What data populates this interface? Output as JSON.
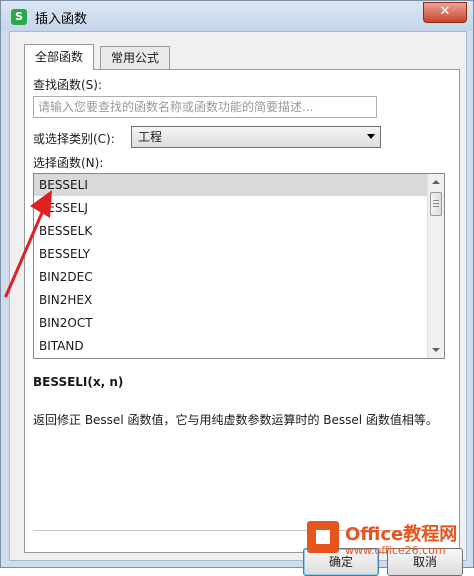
{
  "window": {
    "title": "插入函数",
    "app_icon": "S",
    "close_label": "✕"
  },
  "tabs": [
    {
      "label": "全部函数",
      "active": true
    },
    {
      "label": "常用公式",
      "active": false
    }
  ],
  "search": {
    "label": "查找函数(S):",
    "placeholder": "请输入您要查找的函数名称或函数功能的简要描述..."
  },
  "category": {
    "label": "或选择类别(C):",
    "value": "工程"
  },
  "function_list": {
    "label": "选择函数(N):",
    "items": [
      "BESSELI",
      "BESSELJ",
      "BESSELK",
      "BESSELY",
      "BIN2DEC",
      "BIN2HEX",
      "BIN2OCT",
      "BITAND"
    ],
    "selected_index": 0
  },
  "signature": "BESSELI(x, n)",
  "description": "返回修正 Bessel 函数值，它与用纯虚数参数运算时的 Bessel 函数值相等。",
  "buttons": {
    "ok": "确定",
    "cancel": "取消"
  },
  "watermark": {
    "main": "Office教程网",
    "url": "www.office26.com"
  },
  "colors": {
    "annotation_arrow": "#e02020",
    "watermark": "#e8541e",
    "selection": "#d9d9d9"
  }
}
